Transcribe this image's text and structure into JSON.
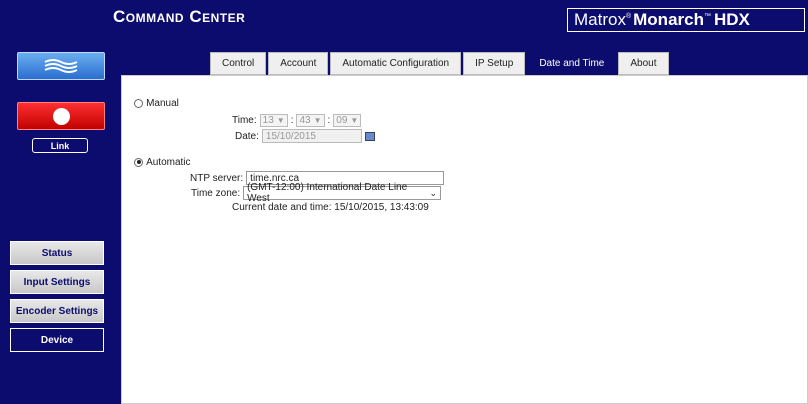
{
  "header": {
    "title": "Command Center",
    "brand_left": "Matrox",
    "brand_right": "Monarch",
    "brand_suffix": "HDX"
  },
  "sidebar": {
    "link_label": "Link",
    "nav": [
      {
        "label": "Status"
      },
      {
        "label": "Input Settings"
      },
      {
        "label": "Encoder Settings"
      },
      {
        "label": "Device"
      }
    ]
  },
  "tabs": [
    "Control",
    "Account",
    "Automatic Configuration",
    "IP Setup",
    "Date and Time",
    "About"
  ],
  "active_tab": "Date and Time",
  "manual": {
    "label": "Manual",
    "time_label": "Time:",
    "hour": "13",
    "minute": "43",
    "second": "09",
    "date_label": "Date:",
    "date_value": "15/10/2015"
  },
  "automatic": {
    "label": "Automatic",
    "ntp_label": "NTP server:",
    "ntp_value": "time.nrc.ca",
    "tz_label": "Time zone:",
    "tz_value": "(GMT-12:00) International Date Line West",
    "current_label": "Current date and time: 15/10/2015, 13:43:09"
  }
}
